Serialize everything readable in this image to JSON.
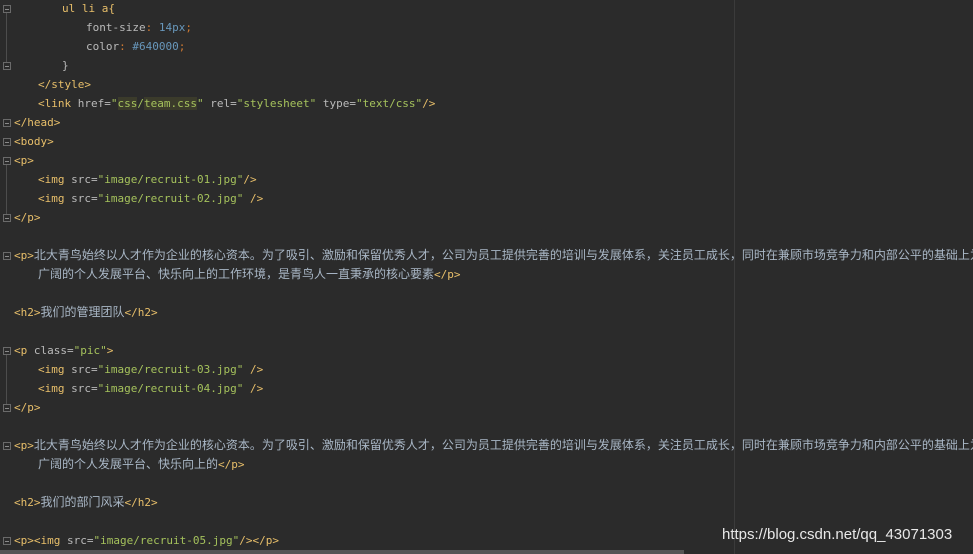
{
  "editor": {
    "lines": [
      [
        {
          "t": "ul li a{",
          "c": "sel"
        }
      ],
      [
        {
          "t": "font-size",
          "c": "prop"
        },
        {
          "t": ": ",
          "c": "punc"
        },
        {
          "t": "14px",
          "c": "num"
        },
        {
          "t": ";",
          "c": "punc"
        }
      ],
      [
        {
          "t": "color",
          "c": "prop"
        },
        {
          "t": ": ",
          "c": "punc"
        },
        {
          "t": "#640000",
          "c": "num"
        },
        {
          "t": ";",
          "c": "punc"
        }
      ],
      [
        {
          "t": "}",
          "c": "attr"
        }
      ],
      [
        {
          "t": "</style>",
          "c": "tag"
        }
      ],
      [
        {
          "t": "<link ",
          "c": "tag"
        },
        {
          "t": "href=",
          "c": "attr"
        },
        {
          "t": "\"",
          "c": "val"
        },
        {
          "t": "css",
          "c": "val hl"
        },
        {
          "t": "/",
          "c": "val"
        },
        {
          "t": "team.css",
          "c": "val hl"
        },
        {
          "t": "\" ",
          "c": "val"
        },
        {
          "t": "rel=",
          "c": "attr"
        },
        {
          "t": "\"stylesheet\" ",
          "c": "val"
        },
        {
          "t": "type=",
          "c": "attr"
        },
        {
          "t": "\"text/css\"",
          "c": "val"
        },
        {
          "t": "/>",
          "c": "tag"
        }
      ],
      [
        {
          "t": "</head>",
          "c": "tag"
        }
      ],
      [
        {
          "t": "<body>",
          "c": "tag"
        }
      ],
      [
        {
          "t": "<p>",
          "c": "tag"
        }
      ],
      [
        {
          "t": "<img ",
          "c": "tag"
        },
        {
          "t": "src=",
          "c": "attr"
        },
        {
          "t": "\"image/recruit-01.jpg\"",
          "c": "val"
        },
        {
          "t": "/>",
          "c": "tag"
        }
      ],
      [
        {
          "t": "<img ",
          "c": "tag"
        },
        {
          "t": "src=",
          "c": "attr"
        },
        {
          "t": "\"image/recruit-02.jpg\" ",
          "c": "val"
        },
        {
          "t": "/>",
          "c": "tag"
        }
      ],
      [
        {
          "t": "</p>",
          "c": "tag"
        }
      ],
      [],
      [
        {
          "t": "<p>",
          "c": "tag"
        },
        {
          "t": "北大青鸟始终以人才作为企业的核心资本。为了吸引、激励和保留优秀人才，公司为员工提供完善的培训与发展体系，关注员工成长，同时在兼顾市场竞争力和内部公平的基础上为",
          "c": "txt"
        }
      ],
      [
        {
          "t": "广阔的个人发展平台、快乐向上的工作环境，是青鸟人一直秉承的核心要素",
          "c": "txt"
        },
        {
          "t": "</p>",
          "c": "tag"
        }
      ],
      [],
      [
        {
          "t": "<h2>",
          "c": "tag"
        },
        {
          "t": "我们的管理团队",
          "c": "txt"
        },
        {
          "t": "</h2>",
          "c": "tag"
        }
      ],
      [],
      [
        {
          "t": "<p ",
          "c": "tag"
        },
        {
          "t": "class=",
          "c": "attr"
        },
        {
          "t": "\"pic\"",
          "c": "val"
        },
        {
          "t": ">",
          "c": "tag"
        }
      ],
      [
        {
          "t": "<img ",
          "c": "tag"
        },
        {
          "t": "src=",
          "c": "attr"
        },
        {
          "t": "\"image/recruit-03.jpg\" ",
          "c": "val"
        },
        {
          "t": "/>",
          "c": "tag"
        }
      ],
      [
        {
          "t": "<img ",
          "c": "tag"
        },
        {
          "t": "src=",
          "c": "attr"
        },
        {
          "t": "\"image/recruit-04.jpg\" ",
          "c": "val"
        },
        {
          "t": "/>",
          "c": "tag"
        }
      ],
      [
        {
          "t": "</p>",
          "c": "tag"
        }
      ],
      [],
      [
        {
          "t": "<p>",
          "c": "tag"
        },
        {
          "t": "北大青鸟始终以人才作为企业的核心资本。为了吸引、激励和保留优秀人才，公司为员工提供完善的培训与发展体系，关注员工成长，同时在兼顾市场竞争力和内部公平的基础上为",
          "c": "txt"
        }
      ],
      [
        {
          "t": "广阔的个人发展平台、快乐向上的",
          "c": "txt"
        },
        {
          "t": "</p>",
          "c": "tag"
        }
      ],
      [],
      [
        {
          "t": "<h2>",
          "c": "tag"
        },
        {
          "t": "我们的部门风采",
          "c": "txt"
        },
        {
          "t": "</h2>",
          "c": "tag"
        }
      ],
      [],
      [
        {
          "t": "<p>",
          "c": "tag"
        },
        {
          "t": "<img ",
          "c": "tag"
        },
        {
          "t": "src=",
          "c": "attr"
        },
        {
          "t": "\"image/recruit-05.jpg\"",
          "c": "val"
        },
        {
          "t": "/>",
          "c": "tag"
        },
        {
          "t": "</p>",
          "c": "tag"
        }
      ]
    ]
  },
  "watermark": "https://blog.csdn.net/qq_43071303"
}
